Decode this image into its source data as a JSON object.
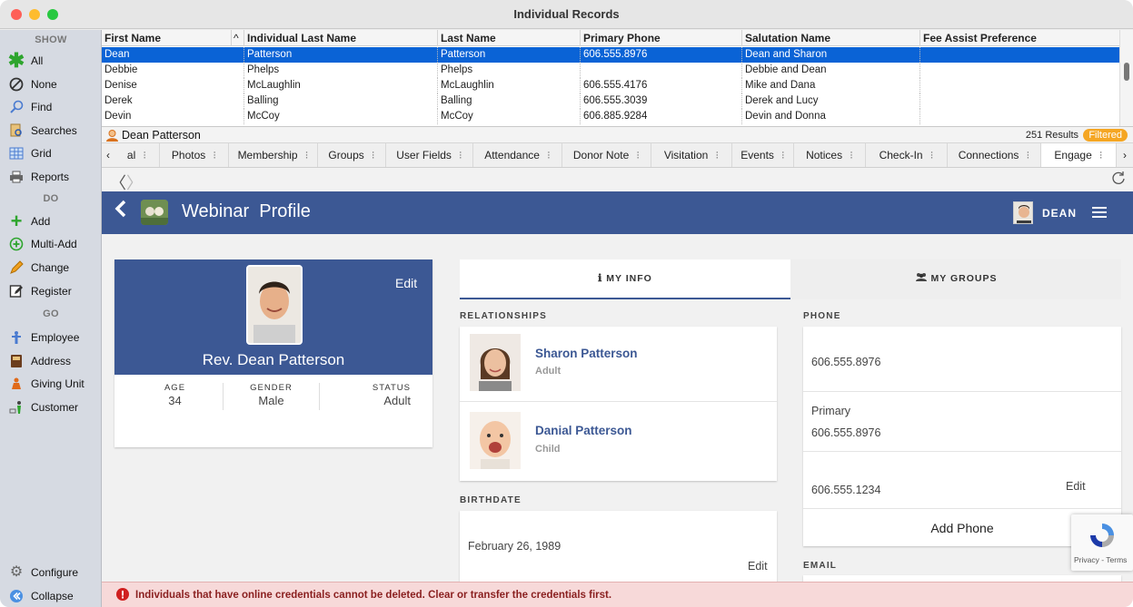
{
  "window": {
    "title": "Individual Records"
  },
  "sidebar": {
    "show_header": "SHOW",
    "do_header": "DO",
    "go_header": "GO",
    "items": [
      {
        "label": "All",
        "icon": "asterisk-icon"
      },
      {
        "label": "None",
        "icon": "none-icon"
      },
      {
        "label": "Find",
        "icon": "magnifier-icon"
      },
      {
        "label": "Searches",
        "icon": "searches-icon"
      },
      {
        "label": "Grid",
        "icon": "grid-icon"
      },
      {
        "label": "Reports",
        "icon": "printer-icon"
      },
      {
        "label": "Add",
        "icon": "plus-icon"
      },
      {
        "label": "Multi-Add",
        "icon": "multi-add-icon"
      },
      {
        "label": "Change",
        "icon": "pencil-icon"
      },
      {
        "label": "Register",
        "icon": "register-icon"
      },
      {
        "label": "Employee",
        "icon": "employee-icon"
      },
      {
        "label": "Address",
        "icon": "address-book-icon"
      },
      {
        "label": "Giving Unit",
        "icon": "giving-unit-icon"
      },
      {
        "label": "Customer",
        "icon": "customer-icon"
      }
    ],
    "configure_label": "Configure",
    "collapse_label": "Collapse"
  },
  "grid": {
    "columns": [
      "First Name",
      "Individual Last Name",
      "Last Name",
      "Primary Phone",
      "Salutation Name",
      "Fee Assist Preference"
    ],
    "sort_indicator": "^",
    "rows": [
      [
        "Dean",
        "Patterson",
        "Patterson",
        "606.555.8976",
        "Dean and Sharon",
        ""
      ],
      [
        "Debbie",
        "Phelps",
        "Phelps",
        "",
        "Debbie and Dean",
        ""
      ],
      [
        "Denise",
        "McLaughlin",
        "McLaughlin",
        "606.555.4176",
        "Mike and Dana",
        ""
      ],
      [
        "Derek",
        "Balling",
        "Balling",
        "606.555.3039",
        "Derek and Lucy",
        ""
      ],
      [
        "Devin",
        "McCoy",
        "McCoy",
        "606.885.9284",
        "Devin and Donna",
        ""
      ]
    ]
  },
  "record_bar": {
    "name": "Dean Patterson",
    "results": "251 Results",
    "filter_badge": "Filtered"
  },
  "tabs": [
    "al",
    "Photos",
    "Membership",
    "Groups",
    "User Fields",
    "Attendance",
    "Donor Note",
    "Visitation",
    "Events",
    "Notices",
    "Check-In",
    "Connections",
    "Engage"
  ],
  "webview": {
    "header_title": "Webinar  Profile",
    "user_name": "DEAN",
    "profile": {
      "edit_label": "Edit",
      "full_name": "Rev. Dean Patterson",
      "stats": [
        {
          "label": "AGE",
          "value": "34"
        },
        {
          "label": "GENDER",
          "value": "Male"
        },
        {
          "label": "STATUS",
          "value": "Adult"
        }
      ]
    },
    "tabs": {
      "my_info": "MY INFO",
      "my_groups": "MY GROUPS"
    },
    "relationships": {
      "title": "RELATIONSHIPS",
      "people": [
        {
          "name": "Sharon Patterson",
          "role": "Adult"
        },
        {
          "name": "Danial Patterson",
          "role": "Child"
        }
      ]
    },
    "birthdate": {
      "title": "BIRTHDATE",
      "value": "February 26, 1989",
      "edit_label": "Edit"
    },
    "phone": {
      "title": "PHONE",
      "entries": [
        {
          "type": "",
          "number": "606.555.8976"
        },
        {
          "type": "Primary",
          "number": "606.555.8976"
        },
        {
          "type": "",
          "number": "606.555.1234"
        }
      ],
      "edit_label": "Edit",
      "add_label": "Add Phone"
    },
    "email": {
      "title": "EMAIL"
    },
    "recaptcha": {
      "text": "Privacy - Terms"
    }
  },
  "error": {
    "message": "Individuals that have online credentials cannot be deleted. Clear or transfer the credentials first."
  }
}
